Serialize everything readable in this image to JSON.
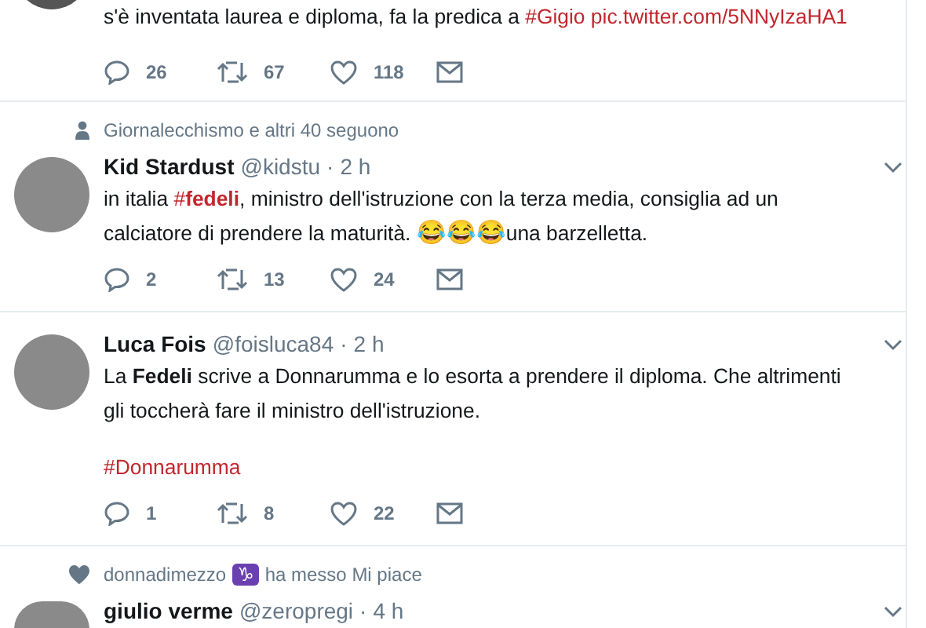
{
  "tweets": [
    {
      "kind": "partial",
      "paragraphs": [
        [
          {
            "text": "s'è inventata laurea e diploma, fa la predica a ",
            "kind": "plain"
          },
          {
            "text": "#Gigio",
            "kind": "link"
          },
          {
            "text": " pic.twitter.com/5NNyIzaHA1",
            "kind": "link"
          }
        ]
      ],
      "actions": {
        "replies": "26",
        "retweets": "67",
        "likes": "118"
      }
    },
    {
      "kind": "full",
      "context": {
        "kind": "follow",
        "parts": [
          {
            "text": "Giornalecchismo e altri 40 seguono",
            "kind": "plain"
          }
        ]
      },
      "author": {
        "name": "Kid Stardust",
        "handle": "@kidstu",
        "separator": "·",
        "time": "2 h"
      },
      "paragraphs": [
        [
          {
            "text": "in italia ",
            "kind": "plain"
          },
          {
            "text": "#",
            "kind": "link"
          },
          {
            "text": "fedeli",
            "kind": "boldlink"
          },
          {
            "text": ", ministro dell'istruzione con la terza media, consiglia ad un calciatore di prendere la maturità. ",
            "kind": "plain"
          },
          {
            "text": "😂😂😂",
            "kind": "emoji"
          },
          {
            "text": "una barzelletta.",
            "kind": "plain"
          }
        ]
      ],
      "actions": {
        "replies": "2",
        "retweets": "13",
        "likes": "24"
      },
      "menu": true
    },
    {
      "kind": "full",
      "author": {
        "name": "Luca Fois",
        "handle": "@foisluca84",
        "separator": "·",
        "time": "2 h"
      },
      "paragraphs": [
        [
          {
            "text": "La ",
            "kind": "plain"
          },
          {
            "text": "Fedeli",
            "kind": "bold"
          },
          {
            "text": " scrive a Donnarumma e lo esorta a prendere il diploma. Che altrimenti gli toccherà fare il ministro dell'istruzione.",
            "kind": "plain"
          }
        ],
        [
          {
            "text": "#Donnarumma",
            "kind": "link"
          }
        ]
      ],
      "actions": {
        "replies": "1",
        "retweets": "8",
        "likes": "22"
      },
      "menu": true
    },
    {
      "kind": "cut",
      "context": {
        "kind": "like",
        "parts": [
          {
            "text": "donnadimezzo",
            "kind": "plain"
          },
          {
            "text": "♑",
            "kind": "badge"
          },
          {
            "text": "ha messo Mi piace",
            "kind": "plain"
          }
        ]
      },
      "author": {
        "name": "giulio verme",
        "handle": "@zeropregi",
        "separator": "·",
        "time": "4 h"
      },
      "menu": true
    }
  ]
}
